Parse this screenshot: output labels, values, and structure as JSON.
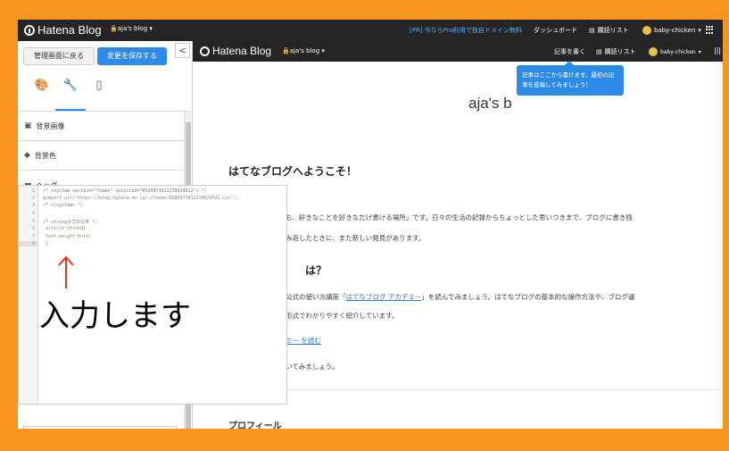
{
  "topbar": {
    "logo": "Hatena Blog",
    "blog_selector": "aja's blog",
    "promo": "[PR] 今ならPro利用で独自ドメイン無料",
    "dashboard": "ダッシュボード",
    "reading_list": "購読リスト",
    "user": "baby-chicken"
  },
  "leftpanel": {
    "back_button": "管理画面に戻る",
    "save_button": "変更を保存する",
    "collapse": "<",
    "tab_icons": [
      "palette-icon",
      "wrench-icon",
      "mobile-icon"
    ],
    "sections": [
      {
        "label": "背景画像",
        "icon": "image-icon"
      },
      {
        "label": "背景色",
        "icon": "paint-icon"
      },
      {
        "label": "ヘッダ",
        "icon": "header-icon"
      }
    ]
  },
  "editor": {
    "line_numbers": [
      "1",
      "2",
      "3",
      "4",
      "5",
      "6",
      "7",
      "8"
    ],
    "lines": [
      "/* <system section=\"theme\" selected=\"8599973812270629022\"> */",
      "@import url(\"https://blog.hatena.ne.jp/-/theme/8599973812270629022.css\");",
      "/* </system> */",
      "",
      "/* strongタグの文末 */",
      " article strong{",
      " font-weight:bold;",
      " }"
    ],
    "annotation_arrow": "↑",
    "annotation_text": "入力します"
  },
  "preview": {
    "logo": "Hatena Blog",
    "blog_selector": "aja's blog",
    "write": "記事を書く",
    "reading_list": "購読リスト",
    "user": "baby-chicken",
    "more": "|||",
    "tooltip": "記事はここから書けます。最初の記事を投稿してみましょう！",
    "blog_title": "aja's b",
    "heading": "はてなブログへようこそ！",
    "para1": "も、好きなことを好きなだけ書ける場所」です。日々の生活の記録からちょっとした思いつきまで、ブログに書き残",
    "para2": "み返したときに、また新しい発見があります。",
    "heading2": "は？",
    "para3_before": "公式の使い方講座「",
    "para3_link": "はてなブログ アカデミー",
    "para3_after": "」を読んでみましょう。はてなブログの基本的な操作方法や、ブログ運",
    "para4": "形式でわかりやすく紹介しています。",
    "link_more": "ミー を読む",
    "para5": "いてみましょう。",
    "profile": "プロフィール"
  }
}
